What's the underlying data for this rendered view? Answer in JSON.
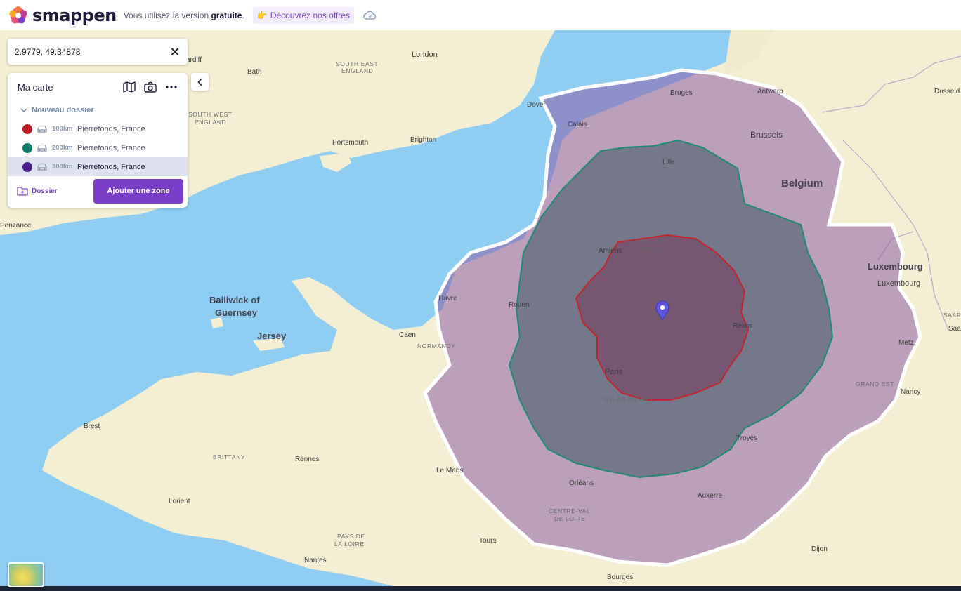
{
  "topbar": {
    "brand": "smappen",
    "version_text_prefix": "Vous utilisez la version ",
    "version_text_bold": "gratuite",
    "version_text_suffix": ".",
    "offer_emoji": "👉",
    "offer_label": "Découvrez nos offres",
    "icons": [
      "smappen-logo-icon",
      "cloud-sync-icon"
    ]
  },
  "search": {
    "value": "2.9779, 49.34878"
  },
  "panel": {
    "title": "Ma carte",
    "folder_label": "Nouveau dossier",
    "zones": [
      {
        "distance": "100km",
        "name": "Pierrefonds, France",
        "color": "#b71c24",
        "selected": false
      },
      {
        "distance": "200km",
        "name": "Pierrefonds, France",
        "color": "#117a68",
        "selected": false
      },
      {
        "distance": "300km",
        "name": "Pierrefonds, France",
        "color": "#4a1d8c",
        "selected": true
      }
    ],
    "dossier_label": "Dossier",
    "add_zone_label": "Ajouter une zone"
  },
  "map": {
    "place_labels": {
      "london": "London",
      "south_east_england": "SOUTH EAST\nENGLAND",
      "south_west_england": "SOUTH WEST\nENGLAND",
      "bath": "Bath",
      "cardiff": "ardiff",
      "dover": "Dover",
      "brighton": "Brighton",
      "portsmouth": "Portsmouth",
      "penzance": "Penzance",
      "bailiwick": "Bailiwick of\nGuernsey",
      "jersey": "Jersey",
      "caen": "Caen",
      "normandy": "NORMANDY",
      "rouen": "Rouen",
      "havre": "Havre",
      "brest": "Brest",
      "brittany": "BRITTANY",
      "rennes": "Rennes",
      "lorient": "Lorient",
      "le_mans": "Le Mans",
      "nantes": "Nantes",
      "pays_de_la_loire": "PAYS DE\nLA LOIRE",
      "tours": "Tours",
      "orleans": "Orléans",
      "centre_val_de_loire": "CENTRE-VAL\nDE LOIRE",
      "paris": "Paris",
      "ile_de_france": "ÎLE-DE-FRANCE",
      "amiens": "Amiens",
      "hauts_de_france": "HAUTS-DE-\nFRANCE",
      "lille": "Lille",
      "calais": "Calais",
      "bruges": "Bruges",
      "antwerp": "Antwerp",
      "brussels": "Brussels",
      "belgium": "Belgium",
      "luxembourg_country": "Luxembourg",
      "luxembourg_city": "Luxembourg",
      "reims": "Reims",
      "metz": "Metz",
      "grand_est": "GRAND EST",
      "nancy": "Nancy",
      "troyes": "Troyes",
      "auxerre": "Auxerre",
      "dijon": "Dijon",
      "bourges": "Bourges",
      "dusseldorf": "Dusseld",
      "saar": "SAAR",
      "saar2": "Saa"
    },
    "marker": "map-pin-icon"
  },
  "colors": {
    "accent": "#7b3ec9",
    "sea": "#8fcef2",
    "land": "#f4efd2",
    "zone_300": "#8e5ca8",
    "zone_200": "#2e6b62",
    "zone_100": "#b71c24"
  }
}
